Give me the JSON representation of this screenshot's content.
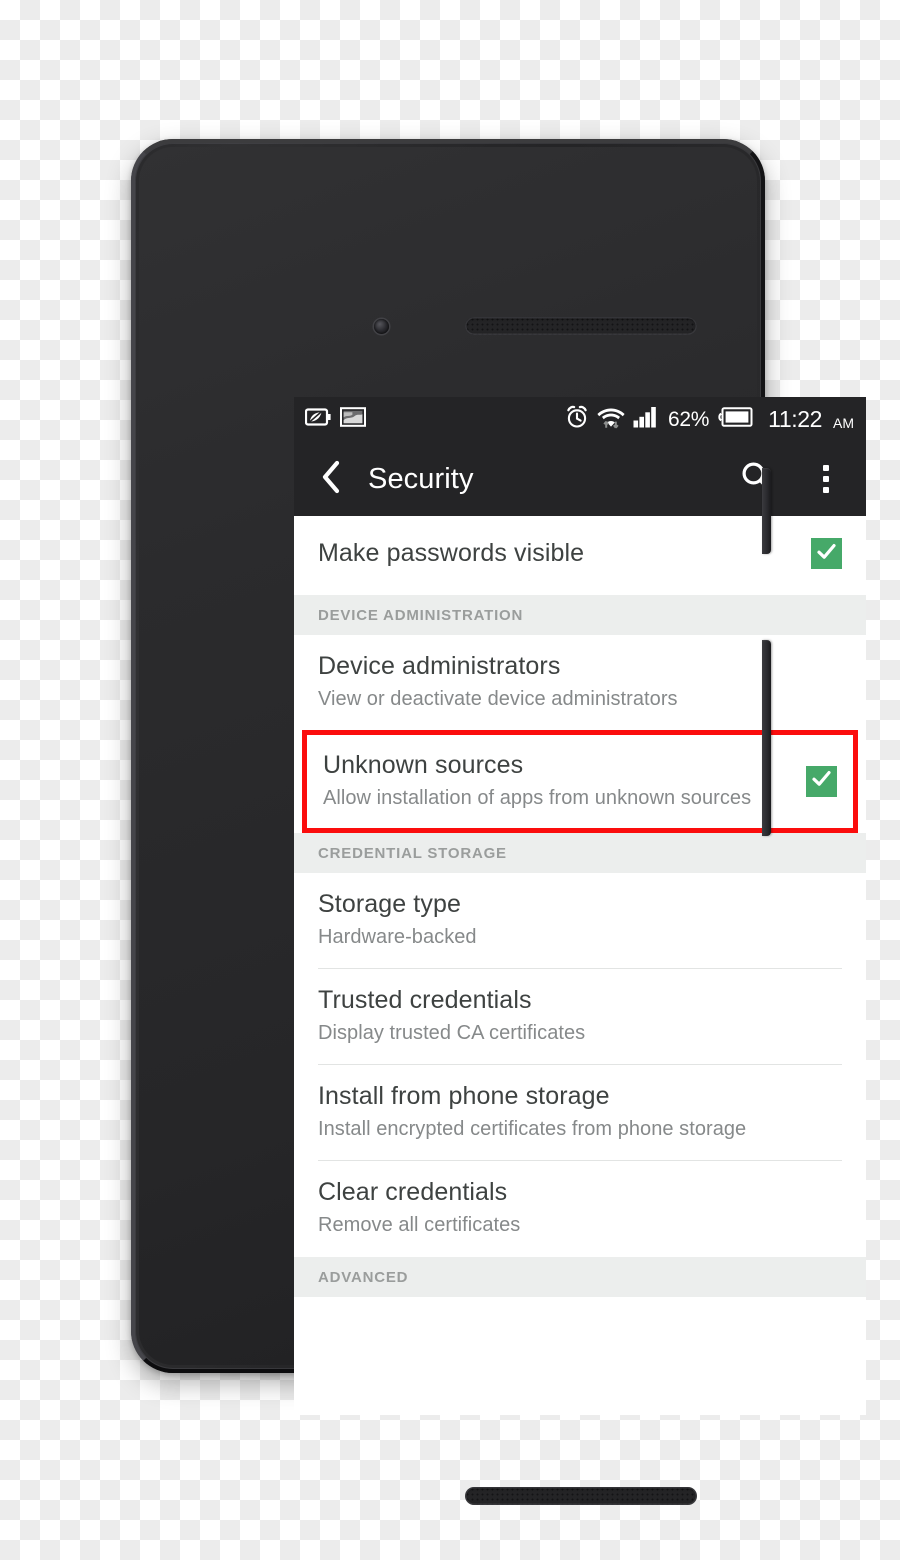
{
  "device": {
    "front_camera": "front-camera",
    "earpiece": "earpiece-speaker",
    "bottom_speaker": "bottom-speaker",
    "power_button": "power-button",
    "volume_button": "volume-rocker-button"
  },
  "status_bar": {
    "left_icons": [
      "eco-battery-icon",
      "screenshot-icon"
    ],
    "right_icons": [
      "alarm-clock-icon",
      "wifi-data-icon",
      "signal-bars-icon"
    ],
    "battery_percent": "62%",
    "battery_icon": "battery-icon",
    "time": "11:22",
    "meridiem": "AM"
  },
  "app_bar": {
    "back_icon": "chevron-left-icon",
    "title": "Security",
    "search_icon": "search-icon",
    "overflow_icon": "overflow-menu-icon"
  },
  "colors": {
    "accent_green": "#46a969",
    "highlight_red": "#fb0d0d",
    "app_bar_bg": "#242426",
    "section_header_bg": "#eceeed"
  },
  "settings": {
    "rows": [
      {
        "name": "make-passwords-visible",
        "title": "Make passwords visible",
        "summary": "",
        "checked": true
      }
    ],
    "sections": [
      {
        "name": "device-administration",
        "header": "DEVICE ADMINISTRATION",
        "rows": [
          {
            "name": "device-administrators",
            "title": "Device administrators",
            "summary": "View or deactivate device administrators",
            "checked": false
          },
          {
            "name": "unknown-sources",
            "title": "Unknown sources",
            "summary": "Allow installation of apps from unknown sources",
            "checked": true,
            "highlighted": true
          }
        ]
      },
      {
        "name": "credential-storage",
        "header": "CREDENTIAL STORAGE",
        "rows": [
          {
            "name": "storage-type",
            "title": "Storage type",
            "summary": "Hardware-backed",
            "checked": false
          },
          {
            "name": "trusted-credentials",
            "title": "Trusted credentials",
            "summary": "Display trusted CA certificates",
            "checked": false
          },
          {
            "name": "install-from-phone-storage",
            "title": "Install from phone storage",
            "summary": "Install encrypted certificates from phone storage",
            "checked": false
          },
          {
            "name": "clear-credentials",
            "title": "Clear credentials",
            "summary": "Remove all certificates",
            "checked": false
          }
        ]
      },
      {
        "name": "advanced",
        "header": "ADVANCED",
        "rows": []
      }
    ]
  }
}
